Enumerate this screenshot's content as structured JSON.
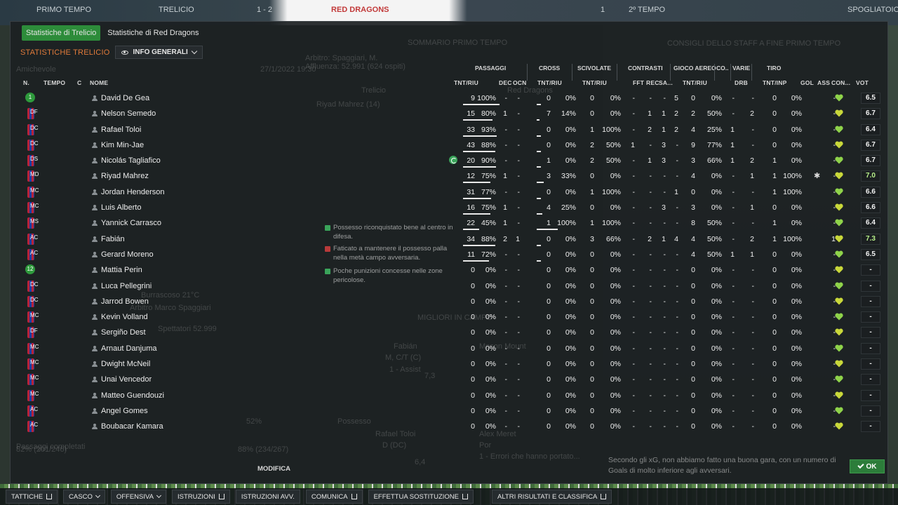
{
  "background": {
    "match_tabs": [
      "PRIMO TEMPO",
      "TRELICIO",
      "1 - 2",
      "RED DRAGONS",
      "1",
      "2º TEMPO",
      "SPOGLIATOIO"
    ],
    "ghost_text": [
      "Amichevole",
      "27/1/2022 19:30",
      "SOMMARIO PRIMO TEMPO",
      "CONSIGLI DELLO STAFF A FINE PRIMO TEMPO",
      "Arbitro: Spaggiari, M.",
      "Affluenza: 52.991 (624 ospiti)",
      "Trelicio",
      "Red Dragons",
      "Riyad Mahrez (14)",
      "Possesso",
      "52%",
      "Passaggi completati",
      "82% (201/246)",
      "88% (234/267)",
      "MIGLIORI IN CAMPO",
      "Fabián",
      "M, C/T (C)",
      "7,3",
      "1 - Assist",
      "Mason Mount",
      "Rafael Toloi",
      "D (DC)",
      "6,4",
      "Alex Meret",
      "Por",
      "1 - Errori che hanno portato...",
      "Burrascoso 21°C",
      "Arbitro Marco Spaggiari",
      "Spettatori 52.999"
    ]
  },
  "tabs": [
    "Statistiche di Trelicio",
    "Statistiche di Red Dragons"
  ],
  "section_title": "STATISTICHE TRELICIO",
  "view_dropdown": "INFO GENERALI",
  "groups": [
    "PASSAGGI",
    "CROSS",
    "SCIVOLATE",
    "CONTRASTI",
    "GIOCO AEREO",
    "CO..",
    "VARIE",
    "TIRO"
  ],
  "columns": {
    "n": "N.",
    "tempo": "TEMPO",
    "c": "C",
    "nome": "NOME",
    "pas_tnt": "TNT/RIU",
    "pas_dec": "DEC",
    "pas_ocn": "OCN",
    "cross": "TNT/RIU",
    "sciv": "TNT/RIU",
    "fft": "FFT",
    "rec": "REC",
    "sa": "SA...",
    "aereo": "TNT/RIU",
    "drb": "DRB",
    "tiro": "TNT/INP",
    "gol": "GOL",
    "ass": "ASS",
    "con": "CON...",
    "vot": "VOT"
  },
  "players": [
    {
      "badge": "1",
      "pos": "",
      "name": "David De Gea",
      "p": [
        "9",
        "100%"
      ],
      "dec": "-",
      "ocn": "-",
      "cr": [
        "0",
        "0%"
      ],
      "sc": [
        "0",
        "0%"
      ],
      "cn": "-",
      "fft": "-",
      "rec": "-",
      "sa": "5",
      "ae": [
        "0",
        "0%"
      ],
      "co": "-",
      "drb": "-",
      "ti": [
        "0",
        "0%"
      ],
      "gol": "",
      "ass": "-",
      "vot": "6.5",
      "bar": 1.0
    },
    {
      "badge": "",
      "pos": "DF",
      "name": "Nelson Semedo",
      "p": [
        "15",
        "80%"
      ],
      "dec": "1",
      "ocn": "-",
      "cr": [
        "7",
        "14%"
      ],
      "sc": [
        "0",
        "0%"
      ],
      "cn": "-",
      "fft": "1",
      "rec": "1",
      "sa": "2",
      "ae": [
        "2",
        "50%"
      ],
      "co": "-",
      "drb": "2",
      "ti": [
        "0",
        "0%"
      ],
      "gol": "",
      "ass": "-",
      "vot": "6.7",
      "bar": 0.8
    },
    {
      "badge": "",
      "pos": "DC",
      "name": "Rafael Toloi",
      "p": [
        "33",
        "93%"
      ],
      "dec": "-",
      "ocn": "-",
      "cr": [
        "0",
        "0%"
      ],
      "sc": [
        "1",
        "100%"
      ],
      "cn": "-",
      "fft": "2",
      "rec": "1",
      "sa": "2",
      "ae": [
        "4",
        "25%"
      ],
      "co": "1",
      "drb": "-",
      "ti": [
        "0",
        "0%"
      ],
      "gol": "",
      "ass": "-",
      "vot": "6.4",
      "bar": 0.93
    },
    {
      "badge": "",
      "pos": "DC",
      "name": "Kim Min-Jae",
      "p": [
        "43",
        "88%"
      ],
      "dec": "-",
      "ocn": "-",
      "cr": [
        "0",
        "0%"
      ],
      "sc": [
        "2",
        "50%"
      ],
      "cn": "1",
      "fft": "-",
      "rec": "3",
      "sa": "-",
      "ae": [
        "9",
        "77%"
      ],
      "co": "1",
      "drb": "-",
      "ti": [
        "0",
        "0%"
      ],
      "gol": "",
      "ass": "-",
      "vot": "6.7",
      "bar": 0.88
    },
    {
      "badge": "",
      "pos": "DS",
      "name": "Nicolás Tagliafico",
      "p": [
        "20",
        "90%"
      ],
      "dec": "-",
      "ocn": "-",
      "cr": [
        "1",
        "0%"
      ],
      "sc": [
        "2",
        "50%"
      ],
      "cn": "-",
      "fft": "1",
      "rec": "3",
      "sa": "-",
      "ae": [
        "3",
        "66%"
      ],
      "co": "1",
      "drb": "2",
      "ti": [
        "1",
        "0%"
      ],
      "gol": "",
      "ass": "-",
      "vot": "6.7",
      "bar": 0.9,
      "subicon": true
    },
    {
      "badge": "",
      "pos": "MD",
      "name": "Riyad Mahrez",
      "p": [
        "12",
        "75%"
      ],
      "dec": "1",
      "ocn": "-",
      "cr": [
        "3",
        "33%"
      ],
      "sc": [
        "0",
        "0%"
      ],
      "cn": "-",
      "fft": "-",
      "rec": "-",
      "sa": "-",
      "ae": [
        "4",
        "0%"
      ],
      "co": "-",
      "drb": "1",
      "ti": [
        "1",
        "100%"
      ],
      "gol": "",
      "ass": "-",
      "vot": "7.0",
      "bar": 0.75,
      "gear": true,
      "hi": true
    },
    {
      "badge": "",
      "pos": "MC",
      "name": "Jordan Henderson",
      "p": [
        "31",
        "77%"
      ],
      "dec": "-",
      "ocn": "-",
      "cr": [
        "0",
        "0%"
      ],
      "sc": [
        "1",
        "100%"
      ],
      "cn": "-",
      "fft": "-",
      "rec": "-",
      "sa": "1",
      "ae": [
        "0",
        "0%"
      ],
      "co": "-",
      "drb": "-",
      "ti": [
        "1",
        "100%"
      ],
      "gol": "",
      "ass": "-",
      "vot": "6.6",
      "bar": 0.77
    },
    {
      "badge": "",
      "pos": "MC",
      "name": "Luis Alberto",
      "p": [
        "16",
        "75%"
      ],
      "dec": "1",
      "ocn": "-",
      "cr": [
        "4",
        "25%"
      ],
      "sc": [
        "0",
        "0%"
      ],
      "cn": "-",
      "fft": "-",
      "rec": "3",
      "sa": "-",
      "ae": [
        "3",
        "0%"
      ],
      "co": "-",
      "drb": "1",
      "ti": [
        "0",
        "0%"
      ],
      "gol": "",
      "ass": "-",
      "vot": "6.6",
      "bar": 0.75
    },
    {
      "badge": "",
      "pos": "MS",
      "name": "Yannick Carrasco",
      "p": [
        "22",
        "45%"
      ],
      "dec": "1",
      "ocn": "-",
      "cr": [
        "1",
        "100%"
      ],
      "sc": [
        "1",
        "100%"
      ],
      "cn": "-",
      "fft": "-",
      "rec": "-",
      "sa": "-",
      "ae": [
        "8",
        "50%"
      ],
      "co": "-",
      "drb": "-",
      "ti": [
        "1",
        "0%"
      ],
      "gol": "",
      "ass": "-",
      "vot": "6.4",
      "bar": 0.45
    },
    {
      "badge": "",
      "pos": "AC",
      "name": "Fabián",
      "p": [
        "34",
        "88%"
      ],
      "dec": "2",
      "ocn": "1",
      "cr": [
        "0",
        "0%"
      ],
      "sc": [
        "3",
        "66%"
      ],
      "cn": "-",
      "fft": "2",
      "rec": "1",
      "sa": "4",
      "ae": [
        "4",
        "50%"
      ],
      "co": "-",
      "drb": "2",
      "ti": [
        "1",
        "100%"
      ],
      "gol": "",
      "ass": "1",
      "vot": "7.3",
      "bar": 0.88,
      "hi": true
    },
    {
      "badge": "",
      "pos": "AC",
      "name": "Gerard Moreno",
      "p": [
        "11",
        "72%"
      ],
      "dec": "-",
      "ocn": "-",
      "cr": [
        "0",
        "0%"
      ],
      "sc": [
        "0",
        "0%"
      ],
      "cn": "-",
      "fft": "-",
      "rec": "-",
      "sa": "-",
      "ae": [
        "4",
        "50%"
      ],
      "co": "1",
      "drb": "1",
      "ti": [
        "0",
        "0%"
      ],
      "gol": "",
      "ass": "-",
      "vot": "6.5",
      "bar": 0.72
    },
    {
      "badge": "12",
      "pos": "",
      "name": "Mattia Perin",
      "p": [
        "0",
        "0%"
      ],
      "dec": "-",
      "ocn": "-",
      "cr": [
        "0",
        "0%"
      ],
      "sc": [
        "0",
        "0%"
      ],
      "cn": "-",
      "fft": "-",
      "rec": "-",
      "sa": "-",
      "ae": [
        "0",
        "0%"
      ],
      "co": "-",
      "drb": "-",
      "ti": [
        "0",
        "0%"
      ],
      "gol": "",
      "ass": "-",
      "vot": "-",
      "bar": 0
    },
    {
      "badge": "",
      "pos": "DC",
      "name": "Luca Pellegrini",
      "p": [
        "0",
        "0%"
      ],
      "dec": "-",
      "ocn": "-",
      "cr": [
        "0",
        "0%"
      ],
      "sc": [
        "0",
        "0%"
      ],
      "cn": "-",
      "fft": "-",
      "rec": "-",
      "sa": "-",
      "ae": [
        "0",
        "0%"
      ],
      "co": "-",
      "drb": "-",
      "ti": [
        "0",
        "0%"
      ],
      "gol": "",
      "ass": "-",
      "vot": "-",
      "bar": 0
    },
    {
      "badge": "",
      "pos": "DC",
      "name": "Jarrod Bowen",
      "p": [
        "0",
        "0%"
      ],
      "dec": "-",
      "ocn": "-",
      "cr": [
        "0",
        "0%"
      ],
      "sc": [
        "0",
        "0%"
      ],
      "cn": "-",
      "fft": "-",
      "rec": "-",
      "sa": "-",
      "ae": [
        "0",
        "0%"
      ],
      "co": "-",
      "drb": "-",
      "ti": [
        "0",
        "0%"
      ],
      "gol": "",
      "ass": "-",
      "vot": "-",
      "bar": 0
    },
    {
      "badge": "",
      "pos": "MC",
      "name": "Kevin Volland",
      "p": [
        "0",
        "0%"
      ],
      "dec": "-",
      "ocn": "-",
      "cr": [
        "0",
        "0%"
      ],
      "sc": [
        "0",
        "0%"
      ],
      "cn": "-",
      "fft": "-",
      "rec": "-",
      "sa": "-",
      "ae": [
        "0",
        "0%"
      ],
      "co": "-",
      "drb": "-",
      "ti": [
        "0",
        "0%"
      ],
      "gol": "",
      "ass": "-",
      "vot": "-",
      "bar": 0
    },
    {
      "badge": "",
      "pos": "DF",
      "name": "Sergiño Dest",
      "p": [
        "0",
        "0%"
      ],
      "dec": "-",
      "ocn": "-",
      "cr": [
        "0",
        "0%"
      ],
      "sc": [
        "0",
        "0%"
      ],
      "cn": "-",
      "fft": "-",
      "rec": "-",
      "sa": "-",
      "ae": [
        "0",
        "0%"
      ],
      "co": "-",
      "drb": "-",
      "ti": [
        "0",
        "0%"
      ],
      "gol": "",
      "ass": "-",
      "vot": "-",
      "bar": 0
    },
    {
      "badge": "",
      "pos": "MC",
      "name": "Arnaut Danjuma",
      "p": [
        "0",
        "0%"
      ],
      "dec": "-",
      "ocn": "-",
      "cr": [
        "0",
        "0%"
      ],
      "sc": [
        "0",
        "0%"
      ],
      "cn": "-",
      "fft": "-",
      "rec": "-",
      "sa": "-",
      "ae": [
        "0",
        "0%"
      ],
      "co": "-",
      "drb": "-",
      "ti": [
        "0",
        "0%"
      ],
      "gol": "",
      "ass": "-",
      "vot": "-",
      "bar": 0
    },
    {
      "badge": "",
      "pos": "MC",
      "name": "Dwight McNeil",
      "p": [
        "0",
        "0%"
      ],
      "dec": "-",
      "ocn": "-",
      "cr": [
        "0",
        "0%"
      ],
      "sc": [
        "0",
        "0%"
      ],
      "cn": "-",
      "fft": "-",
      "rec": "-",
      "sa": "-",
      "ae": [
        "0",
        "0%"
      ],
      "co": "-",
      "drb": "-",
      "ti": [
        "0",
        "0%"
      ],
      "gol": "",
      "ass": "-",
      "vot": "-",
      "bar": 0
    },
    {
      "badge": "",
      "pos": "MC",
      "name": "Unai Vencedor",
      "p": [
        "0",
        "0%"
      ],
      "dec": "-",
      "ocn": "-",
      "cr": [
        "0",
        "0%"
      ],
      "sc": [
        "0",
        "0%"
      ],
      "cn": "-",
      "fft": "-",
      "rec": "-",
      "sa": "-",
      "ae": [
        "0",
        "0%"
      ],
      "co": "-",
      "drb": "-",
      "ti": [
        "0",
        "0%"
      ],
      "gol": "",
      "ass": "-",
      "vot": "-",
      "bar": 0
    },
    {
      "badge": "",
      "pos": "MC",
      "name": "Matteo Guendouzi",
      "p": [
        "0",
        "0%"
      ],
      "dec": "-",
      "ocn": "-",
      "cr": [
        "0",
        "0%"
      ],
      "sc": [
        "0",
        "0%"
      ],
      "cn": "-",
      "fft": "-",
      "rec": "-",
      "sa": "-",
      "ae": [
        "0",
        "0%"
      ],
      "co": "-",
      "drb": "-",
      "ti": [
        "0",
        "0%"
      ],
      "gol": "",
      "ass": "-",
      "vot": "-",
      "bar": 0
    },
    {
      "badge": "",
      "pos": "AC",
      "name": "Angel Gomes",
      "p": [
        "0",
        "0%"
      ],
      "dec": "-",
      "ocn": "-",
      "cr": [
        "0",
        "0%"
      ],
      "sc": [
        "0",
        "0%"
      ],
      "cn": "-",
      "fft": "-",
      "rec": "-",
      "sa": "-",
      "ae": [
        "0",
        "0%"
      ],
      "co": "-",
      "drb": "-",
      "ti": [
        "0",
        "0%"
      ],
      "gol": "",
      "ass": "-",
      "vot": "-",
      "bar": 0
    },
    {
      "badge": "",
      "pos": "AC",
      "name": "Boubacar Kamara",
      "p": [
        "0",
        "0%"
      ],
      "dec": "-",
      "ocn": "-",
      "cr": [
        "0",
        "0%"
      ],
      "sc": [
        "0",
        "0%"
      ],
      "cn": "-",
      "fft": "-",
      "rec": "-",
      "sa": "-",
      "ae": [
        "0",
        "0%"
      ],
      "co": "-",
      "drb": "-",
      "ti": [
        "0",
        "0%"
      ],
      "gol": "",
      "ass": "-",
      "vot": "-",
      "bar": 0
    }
  ],
  "feedback": [
    {
      "text": "Possesso riconquistato bene al centro in difesa.",
      "kind": "good"
    },
    {
      "text": "Faticato a mantenere il possesso palla nella metà campo avversaria.",
      "kind": "bad"
    },
    {
      "text": "Poche punizioni concesse nelle zone pericolose.",
      "kind": "good"
    }
  ],
  "staff_note": "Secondo gli xG, non abbiamo fatto una buona gara, con un numero di Goals di molto inferiore agli avversari.",
  "modify_label": "MODIFICA",
  "ok_label": "OK",
  "toolbar": [
    {
      "label": "TATTICHE",
      "type": "ext"
    },
    {
      "label": "CASCO",
      "type": "drop"
    },
    {
      "label": "OFFENSIVA",
      "type": "drop"
    },
    {
      "label": "ISTRUZIONI",
      "type": "ext"
    },
    {
      "label": "ISTRUZIONI AVV.",
      "type": "none"
    },
    {
      "label": "COMUNICA",
      "type": "ext"
    },
    {
      "label": "EFFETTUA SOSTITUZIONE",
      "type": "ext"
    },
    {
      "label": "ALTRI RISULTATI E CLASSIFICA",
      "type": "ext"
    }
  ],
  "colors": {
    "accent": "#2d8c3a",
    "section": "#e07a3a",
    "heart": "#8fd34a",
    "heart_alt": "#c9d83a"
  }
}
